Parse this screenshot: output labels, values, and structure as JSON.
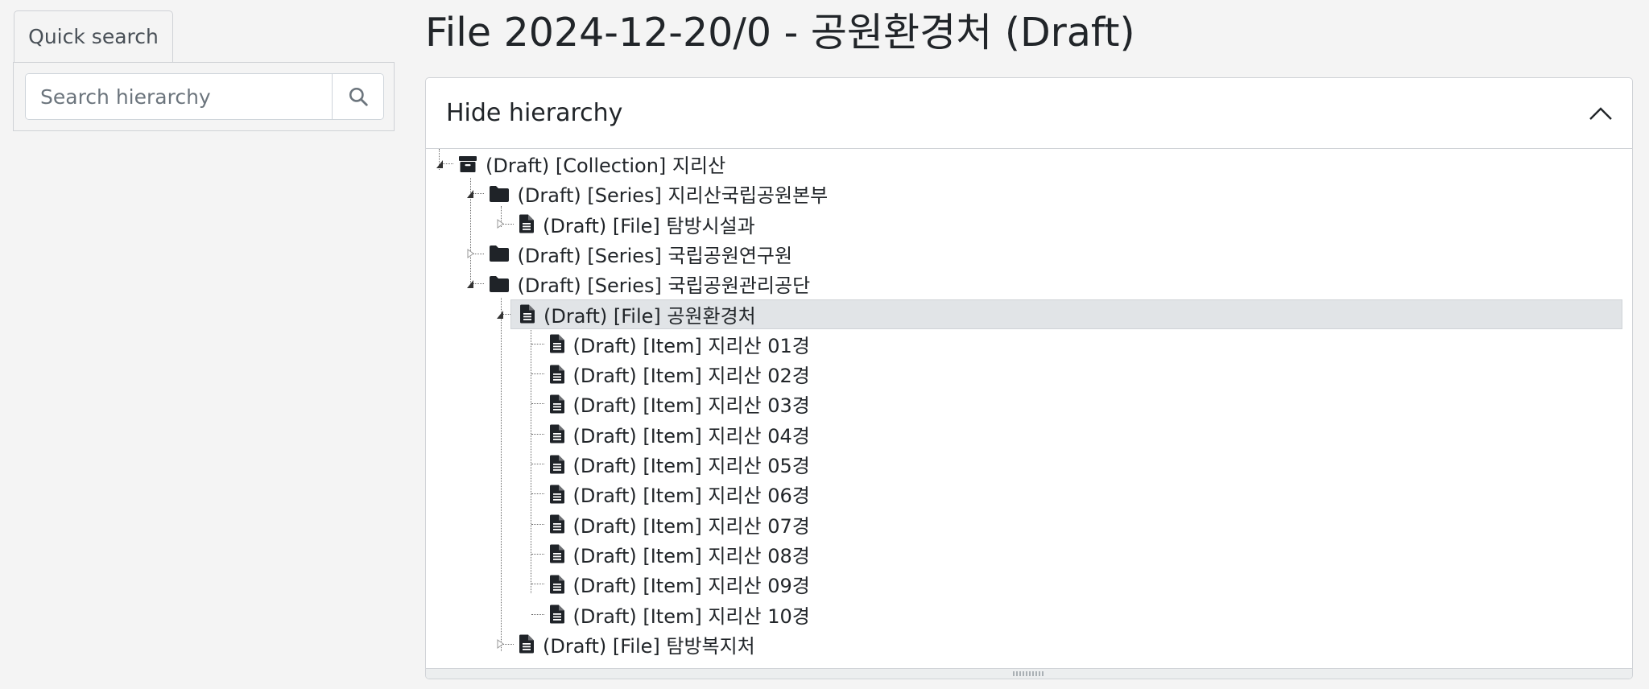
{
  "sidebar": {
    "tab_label": "Quick search",
    "search_placeholder": "Search hierarchy",
    "search_icon": "magnifier-icon"
  },
  "page": {
    "title": "File 2024-12-20/0 - 공원환경처 (Draft)"
  },
  "hierarchy": {
    "header_label": "Hide hierarchy",
    "header_icon": "chevron-up-icon",
    "nodes": [
      {
        "label": "(Draft) [Collection] 지리산",
        "icon": "archive-box-icon",
        "level": 0,
        "toggle": "expanded",
        "selected": false
      },
      {
        "label": "(Draft) [Series] 지리산국립공원본부",
        "icon": "folder-icon",
        "level": 1,
        "toggle": "expanded",
        "selected": false
      },
      {
        "label": "(Draft) [File] 탐방시설과",
        "icon": "document-icon",
        "level": 2,
        "toggle": "collapsed",
        "selected": false
      },
      {
        "label": "(Draft) [Series] 국립공원연구원",
        "icon": "folder-icon",
        "level": 1,
        "toggle": "collapsed",
        "selected": false
      },
      {
        "label": "(Draft) [Series] 국립공원관리공단",
        "icon": "folder-icon",
        "level": 1,
        "toggle": "expanded",
        "selected": false
      },
      {
        "label": "(Draft) [File] 공원환경처",
        "icon": "document-icon",
        "level": 2,
        "toggle": "expanded",
        "selected": true
      },
      {
        "label": "(Draft) [Item] 지리산 01경",
        "icon": "document-icon",
        "level": 3,
        "toggle": "none",
        "selected": false
      },
      {
        "label": "(Draft) [Item] 지리산 02경",
        "icon": "document-icon",
        "level": 3,
        "toggle": "none",
        "selected": false
      },
      {
        "label": "(Draft) [Item] 지리산 03경",
        "icon": "document-icon",
        "level": 3,
        "toggle": "none",
        "selected": false
      },
      {
        "label": "(Draft) [Item] 지리산 04경",
        "icon": "document-icon",
        "level": 3,
        "toggle": "none",
        "selected": false
      },
      {
        "label": "(Draft) [Item] 지리산 05경",
        "icon": "document-icon",
        "level": 3,
        "toggle": "none",
        "selected": false
      },
      {
        "label": "(Draft) [Item] 지리산 06경",
        "icon": "document-icon",
        "level": 3,
        "toggle": "none",
        "selected": false
      },
      {
        "label": "(Draft) [Item] 지리산 07경",
        "icon": "document-icon",
        "level": 3,
        "toggle": "none",
        "selected": false
      },
      {
        "label": "(Draft) [Item] 지리산 08경",
        "icon": "document-icon",
        "level": 3,
        "toggle": "none",
        "selected": false
      },
      {
        "label": "(Draft) [Item] 지리산 09경",
        "icon": "document-icon",
        "level": 3,
        "toggle": "none",
        "selected": false
      },
      {
        "label": "(Draft) [Item] 지리산 10경",
        "icon": "document-icon",
        "level": 3,
        "toggle": "none",
        "selected": false
      },
      {
        "label": "(Draft) [File] 탐방복지처",
        "icon": "document-icon",
        "level": 2,
        "toggle": "collapsed",
        "selected": false
      }
    ]
  },
  "colors": {
    "background": "#f4f4f4",
    "selected_row": "#e1e4e7",
    "text": "#212529",
    "icon": "#1f2328"
  }
}
